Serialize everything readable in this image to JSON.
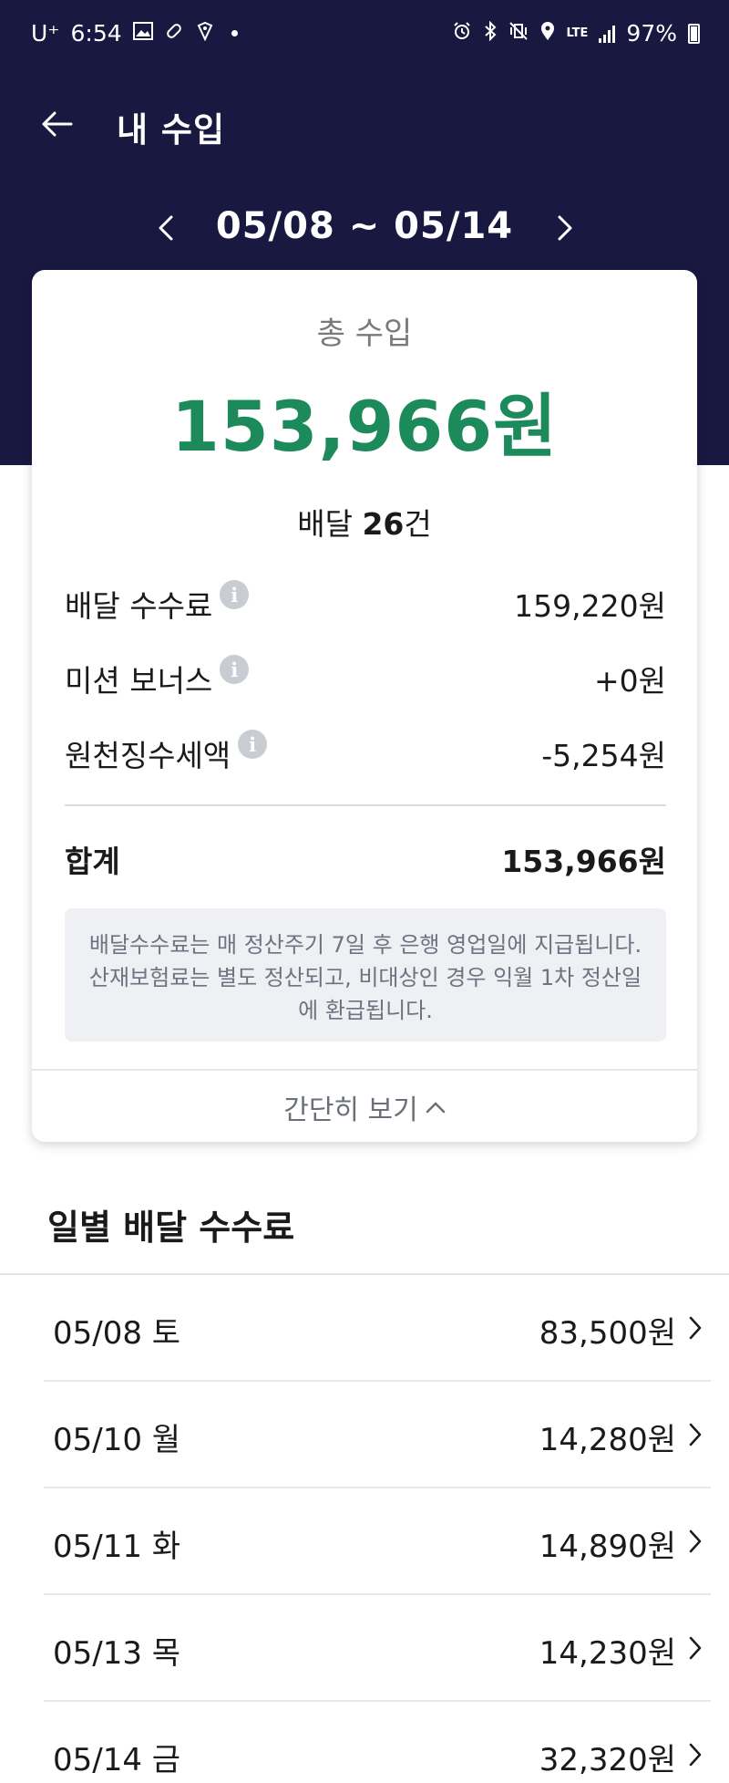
{
  "status_bar": {
    "carrier": "U⁺",
    "time": "6:54",
    "network": "LTE",
    "battery": "97%"
  },
  "header": {
    "title": "내 수입"
  },
  "period": {
    "label": "05/08 ~ 05/14"
  },
  "summary": {
    "total_label": "총 수입",
    "total_amount": "153,966원",
    "delivery_prefix": "배달 ",
    "delivery_count": "26",
    "delivery_suffix": "건",
    "rows": [
      {
        "label": "배달 수수료",
        "value": "159,220원"
      },
      {
        "label": "미션 보너스",
        "value": "+0원"
      },
      {
        "label": "원천징수세액",
        "value": "-5,254원"
      }
    ],
    "sum_label": "합계",
    "sum_value": "153,966원",
    "notice": "배달수수료는 매 정산주기 7일 후 은행 영업일에 지급됩니다. 산재보험료는 별도 정산되고, 비대상인 경우 익월 1차 정산일에 환급됩니다.",
    "collapse_label": "간단히 보기"
  },
  "daily": {
    "title": "일별 배달 수수료",
    "items": [
      {
        "date": "05/08 토",
        "amount": "83,500원"
      },
      {
        "date": "05/10 월",
        "amount": "14,280원"
      },
      {
        "date": "05/11 화",
        "amount": "14,890원"
      },
      {
        "date": "05/13 목",
        "amount": "14,230원"
      },
      {
        "date": "05/14 금",
        "amount": "32,320원"
      }
    ]
  },
  "colors": {
    "header_bg": "#191840",
    "total_amount": "#1c8a5a",
    "notice_bg": "#eef0f4"
  }
}
